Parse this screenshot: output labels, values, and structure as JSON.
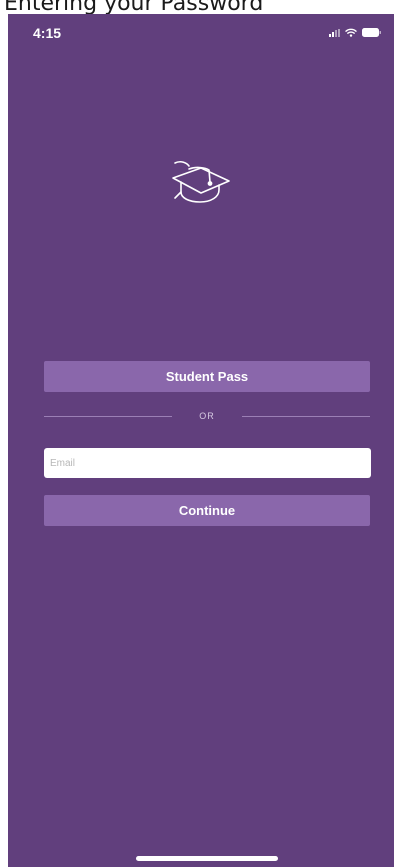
{
  "caption": "Entering your Password",
  "status_bar": {
    "time": "4:15",
    "icons": [
      "signal-icon",
      "wifi-icon",
      "battery-icon"
    ]
  },
  "logo": {
    "icon": "graduation-cap-icon"
  },
  "student_pass_button": {
    "label": "Student Pass"
  },
  "divider": {
    "text": "OR"
  },
  "email_field": {
    "value": "",
    "placeholder": "Email"
  },
  "continue_button": {
    "label": "Continue"
  },
  "colors": {
    "background": "#613f7d",
    "button": "#8a67ab",
    "text": "#ffffff"
  }
}
